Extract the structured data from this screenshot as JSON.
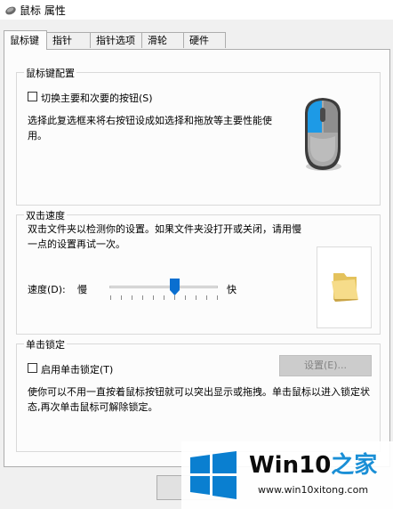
{
  "window": {
    "title": "鼠标 属性"
  },
  "tabs": [
    {
      "label": "鼠标键",
      "active": true
    },
    {
      "label": "指针",
      "active": false
    },
    {
      "label": "指针选项",
      "active": false
    },
    {
      "label": "滑轮",
      "active": false
    },
    {
      "label": "硬件",
      "active": false
    }
  ],
  "button_config": {
    "title": "鼠标键配置",
    "checkbox_label": "切换主要和次要的按钮(S)",
    "checked": false,
    "description": "选择此复选框来将右按钮设成如选择和拖放等主要性能使用。"
  },
  "double_click": {
    "title": "双击速度",
    "description": "双击文件夹以检测你的设置。如果文件夹没打开或关闭，请用慢一点的设置再试一次。",
    "speed_label": "速度(D):",
    "slow_label": "慢",
    "fast_label": "快",
    "speed_level": 0.6
  },
  "click_lock": {
    "title": "单击锁定",
    "checkbox_label": "启用单击锁定(T)",
    "checked": false,
    "settings_button": "设置(E)...",
    "description": "使你可以不用一直按着鼠标按钮就可以突出显示或拖拽。单击鼠标以进入锁定状态,再次单击鼠标可解除锁定。"
  },
  "watermark": {
    "title_main": "Win10",
    "title_accent": "之家",
    "url": "www.win10xitong.com"
  },
  "icons": {
    "title": "mouse-title-icon",
    "mouse": "mouse-icon",
    "folder": "folder-icon",
    "logo": "windows-logo-icon"
  },
  "colors": {
    "accent": "#1a8fd6",
    "windows_logo": "#0a7fd0",
    "slider_thumb": "#0a6fd0"
  }
}
